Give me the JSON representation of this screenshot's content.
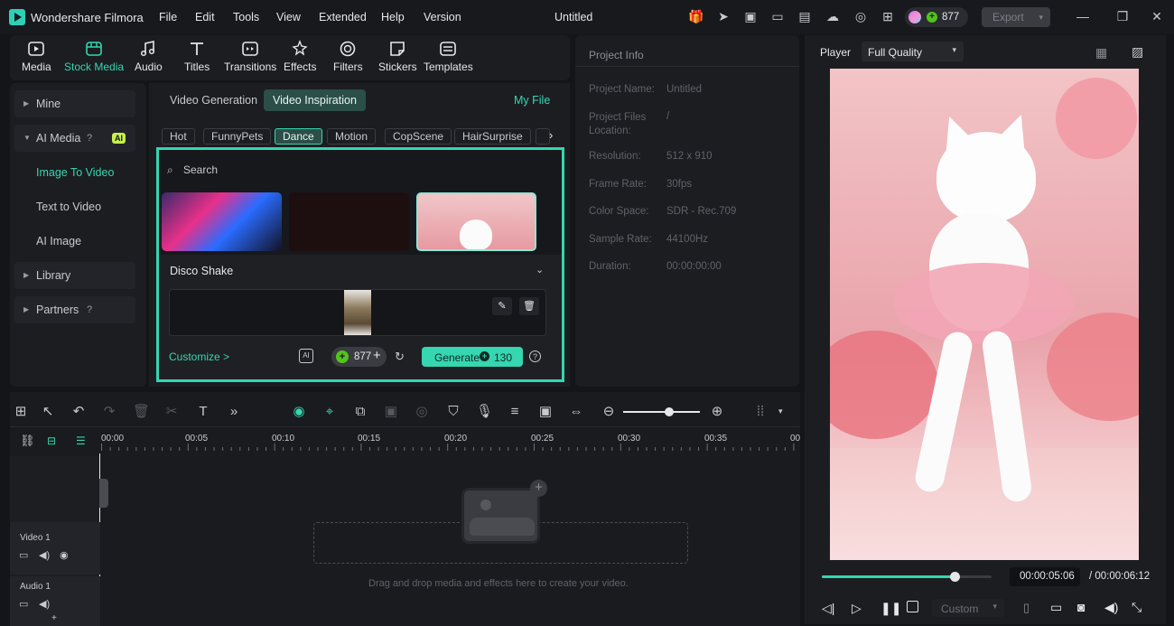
{
  "app": {
    "name": "Wondershare Filmora",
    "window_title": "Untitled"
  },
  "menu": [
    "File",
    "Edit",
    "Tools",
    "View",
    "Extended",
    "Help",
    "Version"
  ],
  "credits": "877",
  "export_label": "Export",
  "toolbar": [
    "Media",
    "Stock Media",
    "Audio",
    "Titles",
    "Transitions",
    "Effects",
    "Filters",
    "Stickers",
    "Templates"
  ],
  "sidebar": {
    "mine": "Mine",
    "ai_media": "AI Media",
    "ai_badge": "AI",
    "image_to_video": "Image To Video",
    "text_to_video": "Text to Video",
    "ai_image": "AI Image",
    "library": "Library",
    "partners": "Partners"
  },
  "tabs": {
    "video_generation": "Video Generation",
    "video_inspiration": "Video Inspiration",
    "my_file": "My File"
  },
  "chips": [
    "Hot",
    "FunnyPets",
    "Dance",
    "Motion",
    "CopScene",
    "HairSurprise"
  ],
  "search_placeholder": "Search",
  "preset_title": "Disco Shake",
  "customize": "Customize >",
  "cost_credits": "877",
  "generate": {
    "label": "Generate",
    "cost": "130"
  },
  "project_info": {
    "title": "Project Info",
    "rows": [
      {
        "k": "Project Name:",
        "v": "Untitled"
      },
      {
        "k": "Project Files Location:",
        "v": "/"
      },
      {
        "k": "Resolution:",
        "v": "512 x 910"
      },
      {
        "k": "Frame Rate:",
        "v": "30fps"
      },
      {
        "k": "Color Space:",
        "v": "SDR - Rec.709"
      },
      {
        "k": "Sample Rate:",
        "v": "44100Hz"
      },
      {
        "k": "Duration:",
        "v": "00:00:00:00"
      }
    ]
  },
  "player": {
    "label": "Player",
    "quality": "Full Quality",
    "current": "00:00:05:06",
    "total": "/ 00:00:06:12",
    "progress": 0.78,
    "speed": "Custom"
  },
  "timeline": {
    "ticks": [
      "00:00",
      "00:05",
      "00:10",
      "00:15",
      "00:20",
      "00:25",
      "00:30",
      "00:35",
      "00"
    ],
    "track_video": "Video 1",
    "track_audio": "Audio 1",
    "drop_hint": "Drag and drop media and effects here to create your video."
  },
  "colors": {
    "accent": "#35d6b0",
    "bg": "#141519",
    "panel": "#1c1d21"
  }
}
